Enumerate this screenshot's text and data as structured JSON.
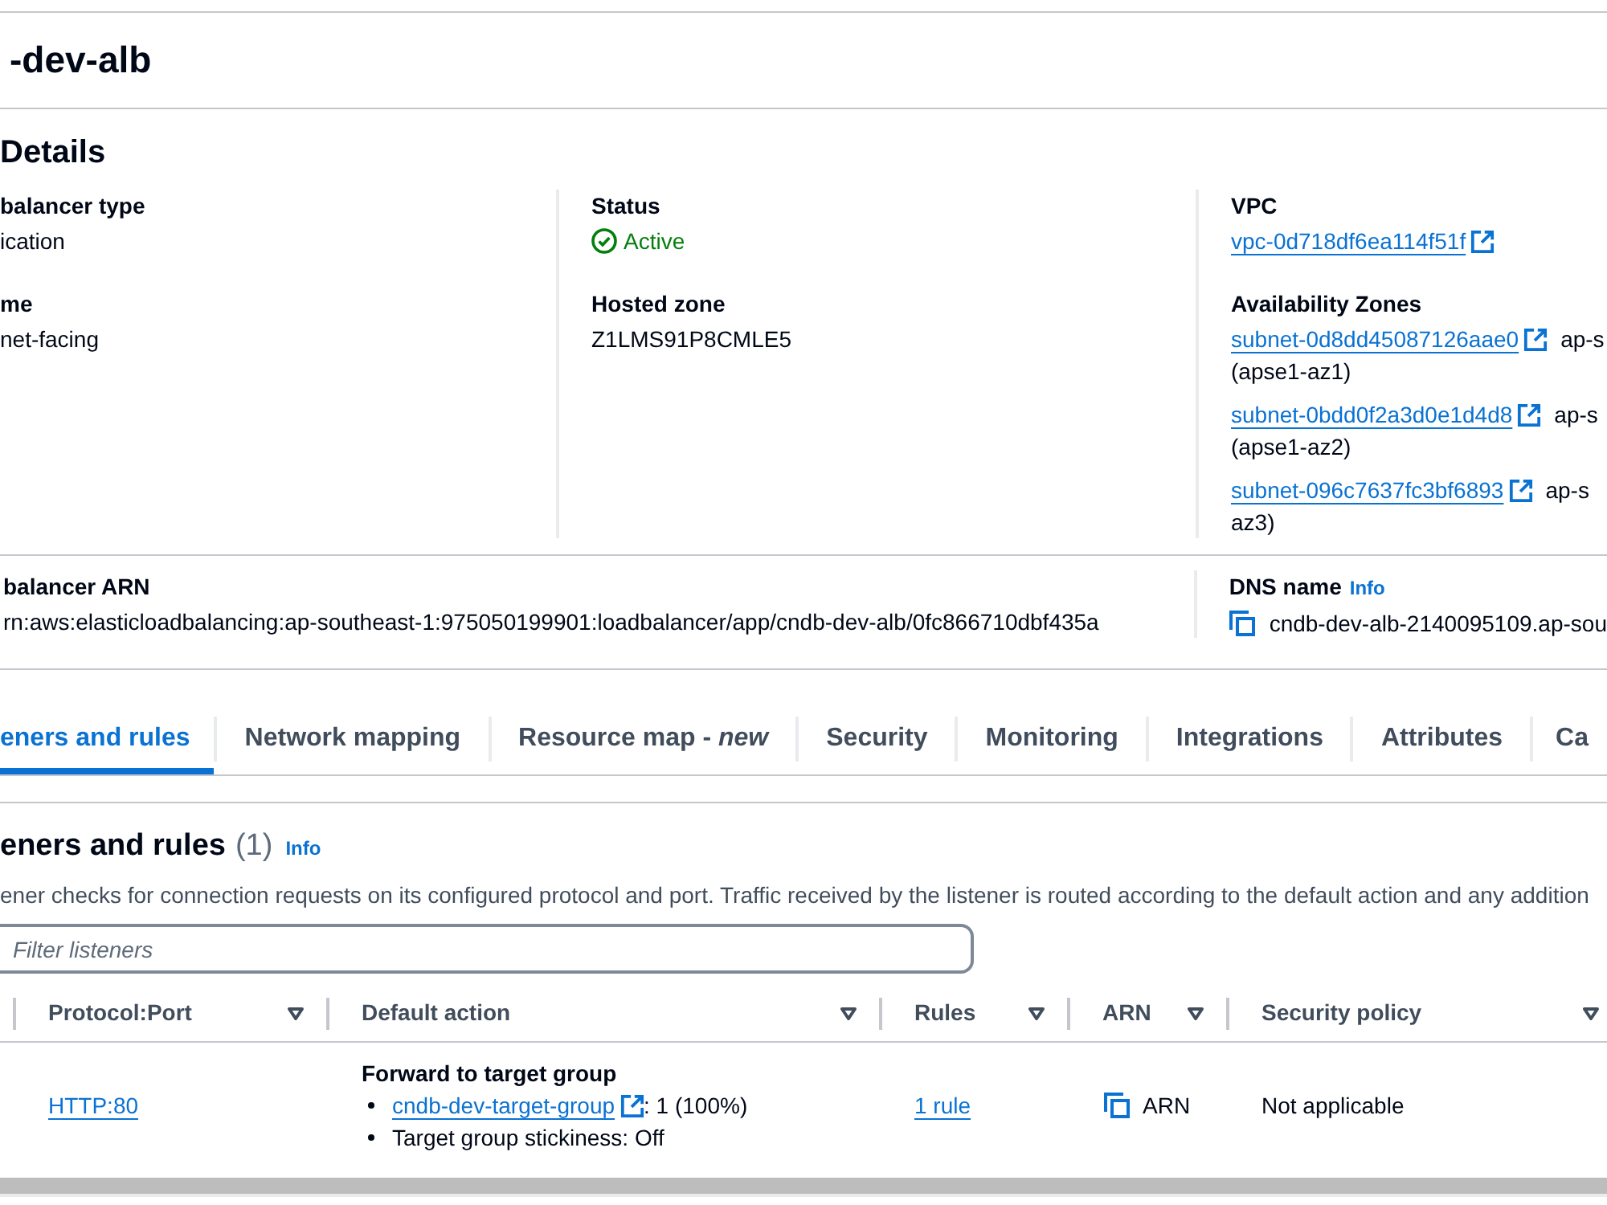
{
  "header": {
    "title": "-dev-alb"
  },
  "details": {
    "title": "Details",
    "columns": [
      [
        {
          "label": "balancer type",
          "kind": "text",
          "value": "ication"
        },
        {
          "label": "me",
          "kind": "text",
          "value": "net-facing"
        }
      ],
      [
        {
          "label": "Status",
          "kind": "status",
          "value": "Active"
        },
        {
          "label": "Hosted zone",
          "kind": "text",
          "value": "Z1LMS91P8CMLE5"
        }
      ],
      [
        {
          "label": "VPC",
          "kind": "link",
          "value": "vpc-0d718df6ea114f51f"
        },
        {
          "label": "Availability Zones",
          "kind": "zones",
          "zones": [
            {
              "subnet": "subnet-0d8dd45087126aae0",
              "zone": "ap-s",
              "zone_id": "(apse1-az1)"
            },
            {
              "subnet": "subnet-0bdd0f2a3d0e1d4d8",
              "zone": "ap-s",
              "zone_id": "(apse1-az2)"
            },
            {
              "subnet": "subnet-096c7637fc3bf6893",
              "zone": "ap-s",
              "zone_id": "az3)"
            }
          ]
        }
      ]
    ],
    "footer_fields": [
      {
        "label": "balancer ARN",
        "kind": "text",
        "value": "rn:aws:elasticloadbalancing:ap-southeast-1:975050199901:loadbalancer/app/cndb-dev-alb/0fc866710dbf435a"
      },
      {
        "label": "DNS name",
        "info": "Info",
        "kind": "copy",
        "value": "cndb-dev-alb-2140095109.ap-sou"
      }
    ]
  },
  "tabs": [
    {
      "label": "eners and rules",
      "selected": true
    },
    {
      "label": "Network mapping",
      "selected": false
    },
    {
      "label": "Resource map - *new*",
      "selected": false
    },
    {
      "label": "Security",
      "selected": false
    },
    {
      "label": "Monitoring",
      "selected": false
    },
    {
      "label": "Integrations",
      "selected": false
    },
    {
      "label": "Attributes",
      "selected": false
    },
    {
      "label": "Ca",
      "selected": false
    }
  ],
  "listeners": {
    "title": "eners and rules",
    "count": "(1)",
    "info": "Info",
    "description": "ener checks for connection requests on its configured protocol and port. Traffic received by the listener is routed according to the default action and any addition",
    "filter": {
      "placeholder": "Filter listeners"
    },
    "columns": [
      "Protocol:Port",
      "Default action",
      "Rules",
      "ARN",
      "Security policy"
    ],
    "rows": [
      {
        "protocol_port": "HTTP:80",
        "default_action": {
          "title": "Forward to target group",
          "target_group": "cndb-dev-target-group",
          "weight": ": 1 (100%)",
          "stickiness": "Target group stickiness: Off"
        },
        "rules": "1 rule",
        "arn": "ARN",
        "security_policy": "Not applicable"
      }
    ]
  }
}
